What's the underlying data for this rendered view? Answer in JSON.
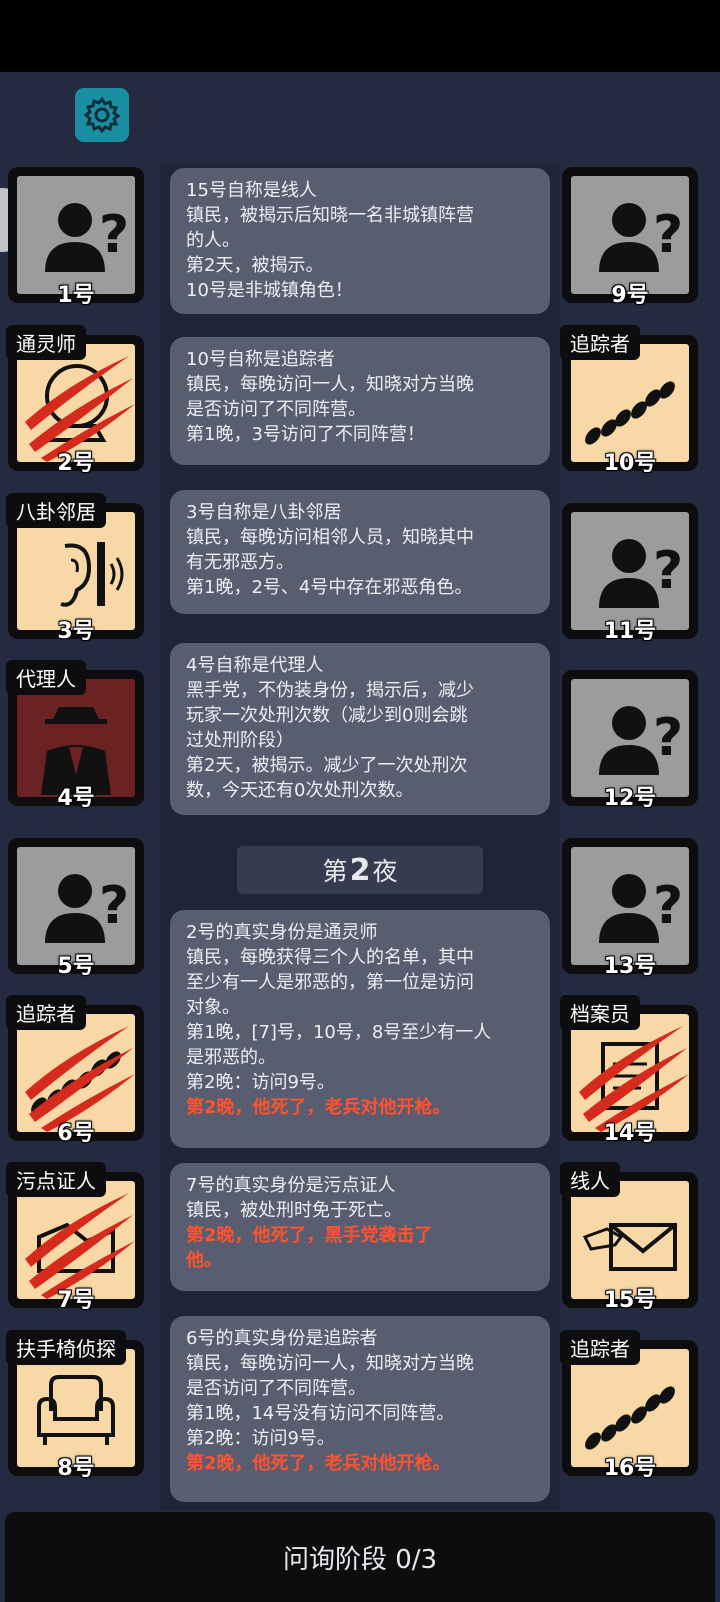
{
  "players": {
    "p1": {
      "num": "1号"
    },
    "p2": {
      "num": "2号",
      "role": "通灵师"
    },
    "p3": {
      "num": "3号",
      "role": "八卦邻居"
    },
    "p4": {
      "num": "4号",
      "role": "代理人"
    },
    "p5": {
      "num": "5号"
    },
    "p6": {
      "num": "6号",
      "role": "追踪者"
    },
    "p7": {
      "num": "7号",
      "role": "污点证人"
    },
    "p8": {
      "num": "8号",
      "role": "扶手椅侦探"
    },
    "p9": {
      "num": "9号"
    },
    "p10": {
      "num": "10号",
      "role": "追踪者"
    },
    "p11": {
      "num": "11号"
    },
    "p12": {
      "num": "12号"
    },
    "p13": {
      "num": "13号"
    },
    "p14": {
      "num": "14号",
      "role": "档案员"
    },
    "p15": {
      "num": "15号",
      "role": "线人"
    },
    "p16": {
      "num": "16号",
      "role": "追踪者"
    }
  },
  "messages": [
    {
      "lines": [
        "15号自称是线人",
        "镇民，被揭示后知晓一名非城镇阵营",
        "的人。",
        "第2天，被揭示。",
        "10号是非城镇角色！"
      ]
    },
    {
      "lines": [
        "10号自称是追踪者",
        "镇民，每晚访问一人，知晓对方当晚",
        "是否访问了不同阵营。",
        "第1晚，3号访问了不同阵营！"
      ]
    },
    {
      "lines": [
        "3号自称是八卦邻居",
        "镇民，每晚访问相邻人员，知晓其中",
        "有无邪恶方。",
        "第1晚，2号、4号中存在邪恶角色。"
      ]
    },
    {
      "lines": [
        "4号自称是代理人",
        "黑手党，不伪装身份，揭示后，减少",
        "玩家一次处刑次数（减少到0则会跳",
        "过处刑阶段）",
        "第2天，被揭示。减少了一次处刑次",
        "数，今天还有0次处刑次数。"
      ]
    },
    {
      "lines": [
        "2号的真实身份是通灵师",
        "镇民，每晚获得三个人的名单，其中",
        "至少有一人是邪恶的，第一位是访问",
        "对象。",
        "第1晚，[7]号，10号，8号至少有一人",
        "是邪恶的。",
        "第2晚：访问9号。"
      ],
      "red": [
        "第2晚，他死了，老兵对他开枪。"
      ]
    },
    {
      "lines": [
        "7号的真实身份是污点证人",
        "镇民，被处刑时免于死亡。"
      ],
      "red": [
        "第2晚，他死了，黑手党袭击了",
        "他。"
      ]
    },
    {
      "lines": [
        "6号的真实身份是追踪者",
        "镇民，每晚访问一人，知晓对方当晚",
        "是否访问了不同阵营。",
        "第1晚，14号没有访问不同阵营。",
        "第2晚：访问9号。"
      ],
      "red": [
        "第2晚，他死了，老兵对他开枪。"
      ]
    }
  ],
  "night": {
    "prefix": "第",
    "number": "2",
    "suffix": "夜"
  },
  "phase": "问询阶段 0/3",
  "colors": {
    "dead_text": "#ff5230",
    "message_bg": "#595d70",
    "settings_bg": "#1a8fa3"
  }
}
